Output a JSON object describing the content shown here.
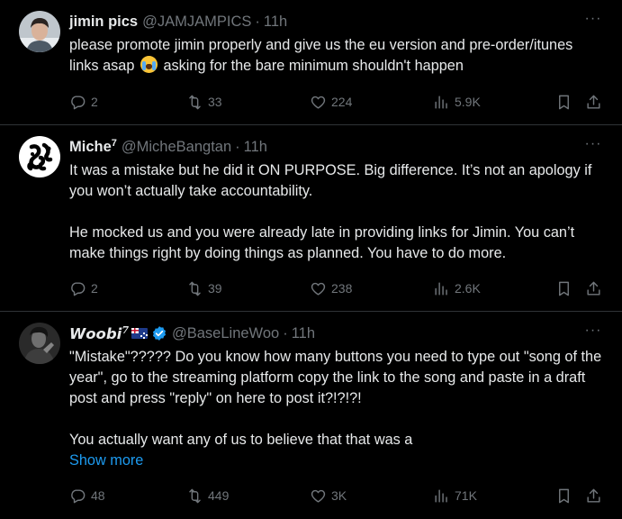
{
  "tweets": [
    {
      "name": "jimin pics",
      "handle": "@JAMJAMPICS",
      "separator": "·",
      "time": "11h",
      "more": "···",
      "text_before_emoji": "please promote jimin properly and give us the eu version and pre-order/itunes links asap ",
      "emoji": "loudly-crying-face",
      "text_after_emoji": " asking for the bare minimum shouldn't happen",
      "replies": "2",
      "reposts": "33",
      "likes": "224",
      "views": "5.9K"
    },
    {
      "name": "Miche",
      "name_sup": "7",
      "handle": "@MicheBangtan",
      "separator": "·",
      "time": "11h",
      "more": "···",
      "paragraphs": [
        "It was a mistake but he did it ON PURPOSE. Big difference. It’s not an apology if you won’t actually take accountability.",
        "He mocked us and you were already late in providing links for Jimin. You can’t make things right by doing things as planned. You have to do more."
      ],
      "replies": "2",
      "reposts": "39",
      "likes": "238",
      "views": "2.6K"
    },
    {
      "name": "𝙒𝙤𝙤𝙗𝙞",
      "name_sup": "7",
      "flag": "australia-flag",
      "verified": true,
      "handle": "@BaseLineWoo",
      "separator": "·",
      "time": "11h",
      "more": "···",
      "paragraphs": [
        "\"Mistake\"????? Do you know how many buttons you need to type out \"song of the year\", go to the streaming platform copy the link to the song and paste in a draft post and press \"reply\" on here to post it?!?!?!",
        "You actually want any of us to believe that that was a"
      ],
      "show_more": "Show more",
      "replies": "48",
      "reposts": "449",
      "likes": "3K",
      "views": "71K"
    }
  ],
  "colors": {
    "background": "#000000",
    "text": "#e7e9ea",
    "muted": "#71767b",
    "link": "#1d9bf0",
    "divider": "#2f3336",
    "verified": "#1d9bf0"
  },
  "icons": [
    "reply-icon",
    "repost-icon",
    "like-icon",
    "views-icon",
    "bookmark-icon",
    "share-icon"
  ]
}
